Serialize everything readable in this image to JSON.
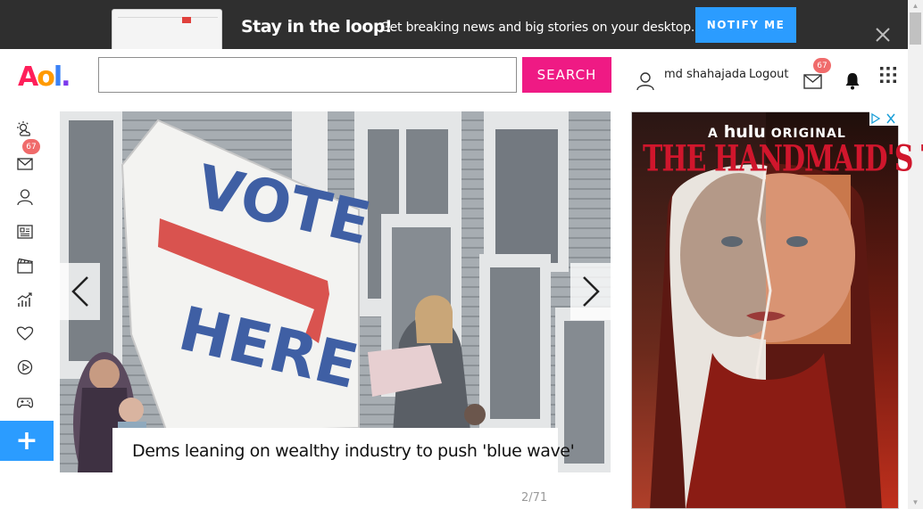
{
  "banner": {
    "title": "Stay in the loop!",
    "subtitle": "Get breaking news and big stories on your desktop.",
    "notify_label": "NOTIFY ME"
  },
  "header": {
    "logo_text": [
      "A",
      "o",
      "l",
      "."
    ],
    "search_placeholder": "",
    "search_label": "SEARCH",
    "username": "md shahajada",
    "logout_label": "Logout",
    "mail_count": "67"
  },
  "rail": {
    "items": [
      "weather-icon",
      "mail-icon",
      "profile-icon",
      "news-icon",
      "movies-icon",
      "finance-icon",
      "health-icon",
      "video-icon",
      "games-icon"
    ],
    "mail_count": "67",
    "add_label": "+"
  },
  "hero": {
    "sign_line1": "VOTE",
    "sign_line2": "HERE",
    "caption": "Dems leaning on wealthy industry to push 'blue wave'",
    "counter": "2/71"
  },
  "ad": {
    "brand_prefix": "A",
    "brand_name": "hulu",
    "brand_suffix": "ORIGINAL",
    "title": "THE HANDMAID'S TALE"
  },
  "colors": {
    "banner_bg": "#2f2f2f",
    "notify_blue": "#2b9cff",
    "search_pink": "#ef1a84",
    "badge_red": "#f06b6b"
  }
}
